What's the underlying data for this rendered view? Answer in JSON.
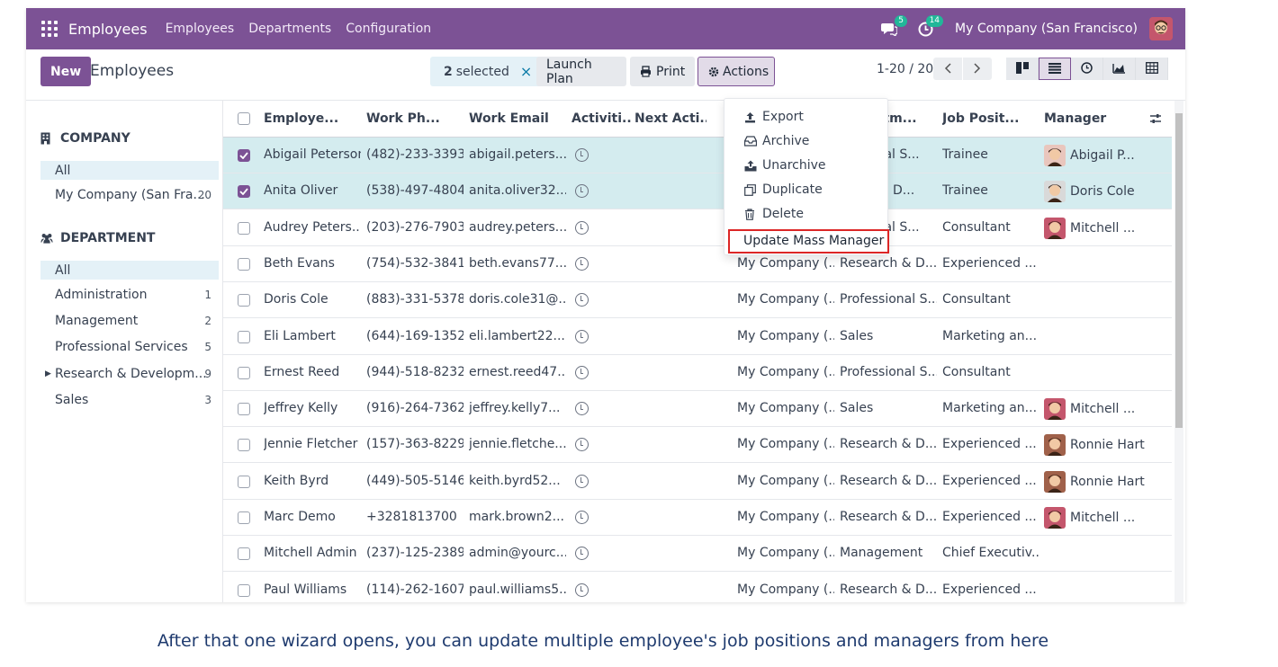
{
  "navbar": {
    "brand": "Employees",
    "menu": [
      "Employees",
      "Departments",
      "Configuration"
    ],
    "messages_badge": "5",
    "activities_badge": "14",
    "company": "My Company (San Francisco)"
  },
  "control": {
    "new_label": "New",
    "title": "Employees",
    "selected_count": "2",
    "selected_label": "selected",
    "clear_icon": "×",
    "launch_plan": "Launch Plan",
    "print": "Print",
    "actions": "Actions",
    "pager": "1-20 / 20"
  },
  "actions_menu": {
    "items": [
      "Export",
      "Archive",
      "Unarchive",
      "Duplicate",
      "Delete"
    ],
    "highlighted": "Update Mass Manager"
  },
  "sidebar": {
    "company_header": "COMPANY",
    "company_items": [
      {
        "label": "All",
        "count": ""
      },
      {
        "label": "My Company (San Fra...",
        "count": "20"
      }
    ],
    "department_header": "DEPARTMENT",
    "department_items": [
      {
        "label": "All",
        "count": ""
      },
      {
        "label": "Administration",
        "count": "1"
      },
      {
        "label": "Management",
        "count": "2"
      },
      {
        "label": "Professional Services",
        "count": "5"
      },
      {
        "label": "Research & Developm...",
        "count": "9"
      },
      {
        "label": "Sales",
        "count": "3"
      }
    ]
  },
  "table": {
    "columns": [
      "Employe...",
      "Work Ph...",
      "Work Email",
      "Activiti...",
      "Next Acti...",
      "",
      "partm...",
      "Job Posit...",
      "Manager"
    ],
    "rows": [
      {
        "name": "Abigail Peterson",
        "phone": "(482)-233-3393",
        "email": "abigail.peters...",
        "company": "",
        "dept": "fessional S...",
        "job": "Trainee",
        "manager": "Abigail P...",
        "selected": true
      },
      {
        "name": "Anita Oliver",
        "phone": "(538)-497-4804",
        "email": "anita.oliver32...",
        "company": "",
        "dept": "earch & D...",
        "job": "Trainee",
        "manager": "Doris Cole",
        "selected": true
      },
      {
        "name": "Audrey Peters...",
        "phone": "(203)-276-7903",
        "email": "audrey.peters...",
        "company": "",
        "dept": "fessional S...",
        "job": "Consultant",
        "manager": "Mitchell ...",
        "selected": false
      },
      {
        "name": "Beth Evans",
        "phone": "(754)-532-3841",
        "email": "beth.evans77...",
        "company": "My Company (...",
        "dept": "Research & D...",
        "job": "Experienced ...",
        "manager": "",
        "selected": false
      },
      {
        "name": "Doris Cole",
        "phone": "(883)-331-5378",
        "email": "doris.cole31@...",
        "company": "My Company (...",
        "dept": "Professional S...",
        "job": "Consultant",
        "manager": "",
        "selected": false
      },
      {
        "name": "Eli Lambert",
        "phone": "(644)-169-1352",
        "email": "eli.lambert22...",
        "company": "My Company (...",
        "dept": "Sales",
        "job": "Marketing an...",
        "manager": "",
        "selected": false
      },
      {
        "name": "Ernest Reed",
        "phone": "(944)-518-8232",
        "email": "ernest.reed47...",
        "company": "My Company (...",
        "dept": "Professional S...",
        "job": "Consultant",
        "manager": "",
        "selected": false
      },
      {
        "name": "Jeffrey Kelly",
        "phone": "(916)-264-7362",
        "email": "jeffrey.kelly7...",
        "company": "My Company (...",
        "dept": "Sales",
        "job": "Marketing an...",
        "manager": "Mitchell ...",
        "selected": false
      },
      {
        "name": "Jennie Fletcher",
        "phone": "(157)-363-8229",
        "email": "jennie.fletche...",
        "company": "My Company (...",
        "dept": "Research & D...",
        "job": "Experienced ...",
        "manager": "Ronnie Hart",
        "selected": false
      },
      {
        "name": "Keith Byrd",
        "phone": "(449)-505-5146",
        "email": "keith.byrd52...",
        "company": "My Company (...",
        "dept": "Research & D...",
        "job": "Experienced ...",
        "manager": "Ronnie Hart",
        "selected": false
      },
      {
        "name": "Marc Demo",
        "phone": "+3281813700",
        "email": "mark.brown2...",
        "company": "My Company (...",
        "dept": "Research & D...",
        "job": "Experienced ...",
        "manager": "Mitchell ...",
        "selected": false
      },
      {
        "name": "Mitchell Admin",
        "phone": "(237)-125-2389",
        "email": "admin@yourc...",
        "company": "My Company (...",
        "dept": "Management",
        "job": "Chief Executiv...",
        "manager": "",
        "selected": false
      },
      {
        "name": "Paul Williams",
        "phone": "(114)-262-1607",
        "email": "paul.williams5...",
        "company": "My Company (...",
        "dept": "Research & D...",
        "job": "Experienced ...",
        "manager": "",
        "selected": false
      }
    ]
  },
  "caption": "After that one wizard opens, you can update multiple employee's job positions and managers from here",
  "colors": {
    "brand": "#7c5295",
    "selected_row": "#d4ecef",
    "highlight": "#dc2626"
  }
}
